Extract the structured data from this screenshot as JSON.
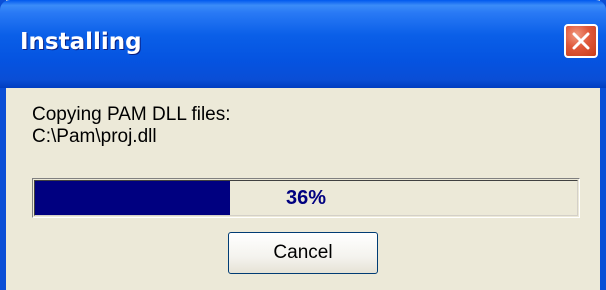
{
  "window": {
    "title": "Installing"
  },
  "message": {
    "line1": "Copying PAM DLL files:",
    "line2": "C:\\Pam\\proj.dll"
  },
  "progress": {
    "value": 0.36,
    "label": "36%",
    "fill_color": "#000080",
    "text_color": "#000080"
  },
  "buttons": {
    "cancel_label": "Cancel"
  },
  "icons": {
    "close": "close-icon"
  },
  "colors": {
    "titlebar": "#0a5fe8",
    "window_bg": "#ece9d8",
    "close_button": "#e0583a"
  }
}
